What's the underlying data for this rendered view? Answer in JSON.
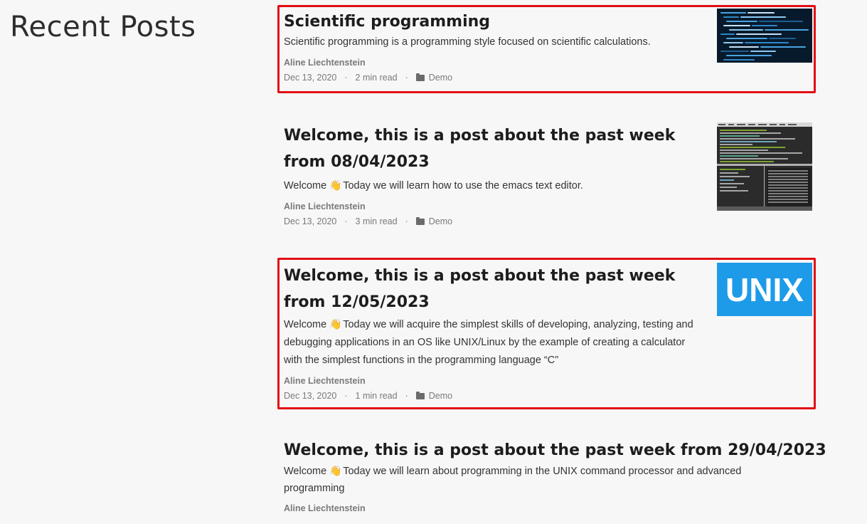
{
  "page": {
    "section_title": "Recent Posts"
  },
  "posts": [
    {
      "title": "Scientific programming",
      "excerpt": "Scientific programming is a programming style focused on scientific calculations.",
      "author": "Aline Liechtenstein",
      "date": "Dec 13, 2020",
      "read_time": "2 min read",
      "category": "Demo",
      "highlighted": true,
      "thumbnail_icon": "code-screen-thumbnail"
    },
    {
      "title": "Welcome, this is a post about the past week from 08/04/2023",
      "emoji": "👋",
      "excerpt": "Today we will learn how to use the emacs text editor.",
      "author": "Aline Liechtenstein",
      "date": "Dec 13, 2020",
      "read_time": "3 min read",
      "category": "Demo",
      "highlighted": false,
      "thumbnail_icon": "emacs-screen-thumbnail"
    },
    {
      "title": "Welcome, this is a post about the past week from 12/05/2023",
      "emoji": "👋",
      "excerpt": "Today we will acquire the simplest skills of developing, analyzing, testing and debugging applications in an OS like UNIX/Linux by the example of creating a calculator with the simplest functions in the programming language “C”",
      "author": "Aline Liechtenstein",
      "date": "Dec 13, 2020",
      "read_time": "1 min read",
      "category": "Demo",
      "highlighted": true,
      "thumbnail_text": "UNIX",
      "thumbnail_color": "#1e9be8"
    },
    {
      "title": "Welcome, this is a post about the past week from 29/04/2023",
      "emoji": "👋",
      "excerpt": "Today we will learn about programming in the UNIX command processor and advanced programming",
      "author": "Aline Liechtenstein"
    }
  ],
  "welcome_word": "Welcome",
  "colors": {
    "highlight_border": "#e30d14",
    "background": "#f7f7f7",
    "meta_text": "#7a7a7a"
  }
}
